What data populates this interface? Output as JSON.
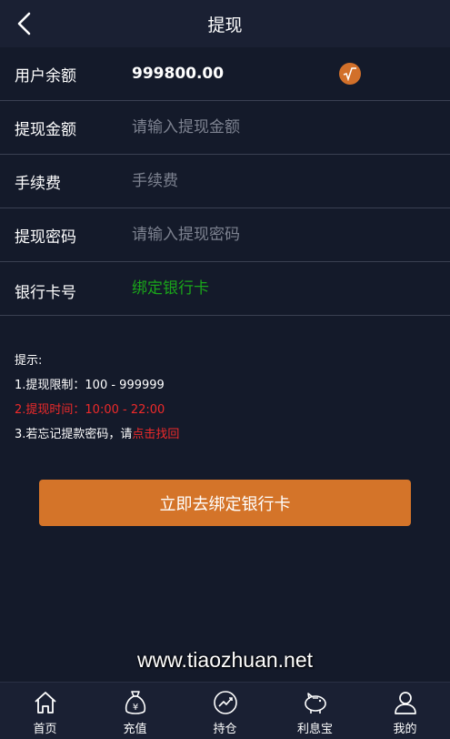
{
  "header": {
    "title": "提现"
  },
  "form": {
    "balance_label": "用户余额",
    "balance_value": "999800.00",
    "amount_label": "提现金额",
    "amount_placeholder": "请输入提现金额",
    "fee_label": "手续费",
    "fee_placeholder": "手续费",
    "password_label": "提现密码",
    "password_placeholder": "请输入提现密码",
    "bank_label": "银行卡号",
    "bank_link": "绑定银行卡"
  },
  "tips": {
    "title": "提示:",
    "line1": "1.提现限制：100 - 999999",
    "line2": "2.提现时间：10:00 - 22:00",
    "line3_prefix": "3.若忘记提款密码，请",
    "line3_link": "点击找回"
  },
  "submit_label": "立即去绑定银行卡",
  "watermark": "www.tiaozhuan.net",
  "tabbar": [
    {
      "label": "首页",
      "icon": "home-icon"
    },
    {
      "label": "充值",
      "icon": "money-bag-icon"
    },
    {
      "label": "持仓",
      "icon": "chart-icon"
    },
    {
      "label": "利息宝",
      "icon": "piggy-bank-icon"
    },
    {
      "label": "我的",
      "icon": "user-icon"
    }
  ],
  "colors": {
    "accent": "#d47429",
    "link_green": "#1aa51a",
    "warn_red": "#ee2a2a"
  }
}
